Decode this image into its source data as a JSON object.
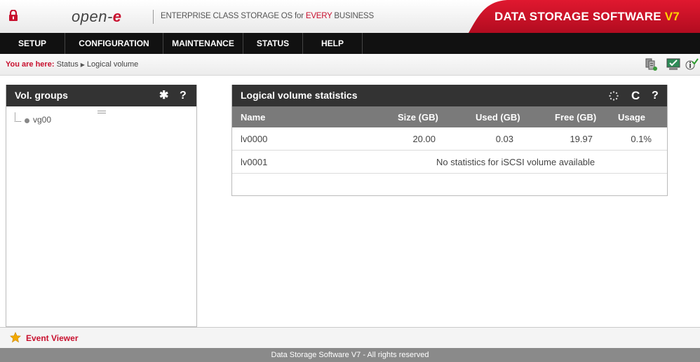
{
  "header": {
    "brand_text": "open-",
    "brand_e": "e",
    "tagline_pre": "ENTERPRISE CLASS STORAGE OS for ",
    "tagline_red": "EVERY",
    "tagline_post": " BUSINESS",
    "product_title": "DATA STORAGE SOFTWARE ",
    "product_version": "V7",
    "accent_color": "#c8102e"
  },
  "nav": [
    {
      "label": "SETUP"
    },
    {
      "label": "CONFIGURATION"
    },
    {
      "label": "MAINTENANCE"
    },
    {
      "label": "STATUS"
    },
    {
      "label": "HELP"
    }
  ],
  "breadcrumb": {
    "prefix": "You are here:",
    "items": [
      "Status",
      "Logical volume"
    ]
  },
  "toolbar_icons": [
    "storage-icon",
    "monitor-check-icon",
    "info-check-icon"
  ],
  "left_panel": {
    "title": "Vol. groups",
    "icons": [
      "gear-icon",
      "help-icon"
    ],
    "tree": [
      {
        "label": "vg00"
      }
    ]
  },
  "stats_panel": {
    "title": "Logical volume statistics",
    "icons": [
      "spinner-icon",
      "refresh-icon",
      "help-icon"
    ],
    "columns": [
      "Name",
      "Size (GB)",
      "Used (GB)",
      "Free (GB)",
      "Usage"
    ],
    "rows": [
      {
        "name": "lv0000",
        "size": "20.00",
        "used": "0.03",
        "free": "19.97",
        "usage": "0.1%"
      },
      {
        "name": "lv0001",
        "note": "No statistics for iSCSI volume available"
      }
    ]
  },
  "footer": {
    "event_viewer": "Event Viewer",
    "copyright": "Data Storage Software V7 - All rights reserved"
  }
}
